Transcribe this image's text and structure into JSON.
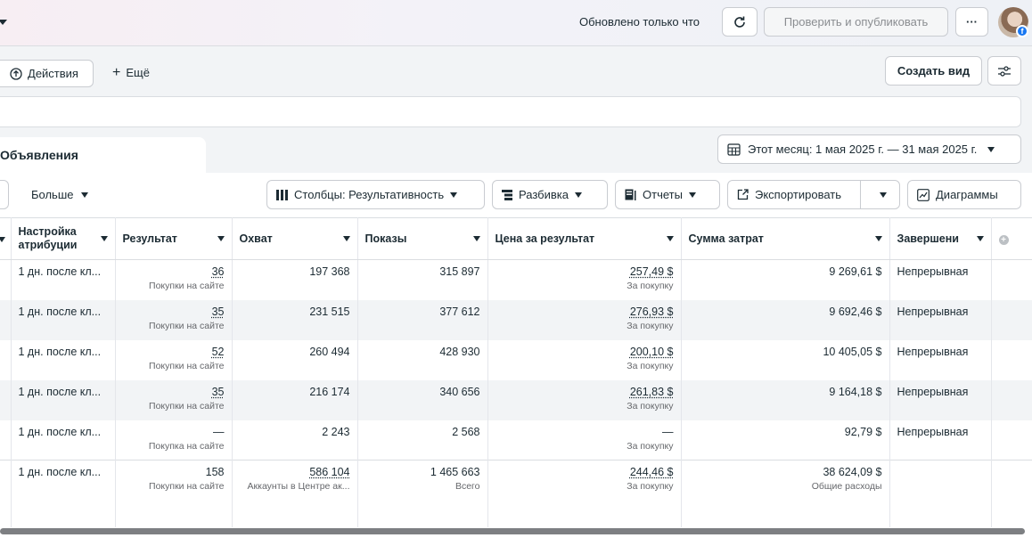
{
  "header": {
    "updated": "Обновлено только что",
    "publish": "Проверить и опубликовать",
    "more": "···"
  },
  "actions": {
    "actions": "Действия",
    "more": "Ещё",
    "create_view": "Создать вид"
  },
  "tab": "Объявления",
  "date_range": "Этот месяц: 1 мая 2025 г. — 31 мая 2025 г.",
  "toolbar": {
    "more": "Больше",
    "columns": "Столбцы: Результативность",
    "breakdown": "Разбивка",
    "reports": "Отчеты",
    "export": "Экспортировать",
    "charts": "Диаграммы"
  },
  "columns": [
    "",
    "Настройка атрибуции",
    "Результат",
    "Охват",
    "Показы",
    "Цена за результат",
    "Сумма затрат",
    "Завершени"
  ],
  "rows": [
    {
      "attr": "1 дн. после кл...",
      "result": "36",
      "result_sub": "Покупки на сайте",
      "reach": "197 368",
      "impr": "315 897",
      "cpr": "257,49 $",
      "cpr_sub": "За покупку",
      "spend": "9 269,61 $",
      "end": "Непрерывная"
    },
    {
      "attr": "1 дн. после кл...",
      "result": "35",
      "result_sub": "Покупки на сайте",
      "reach": "231 515",
      "impr": "377 612",
      "cpr": "276,93 $",
      "cpr_sub": "За покупку",
      "spend": "9 692,46 $",
      "end": "Непрерывная"
    },
    {
      "attr": "1 дн. после кл...",
      "result": "52",
      "result_sub": "Покупки на сайте",
      "reach": "260 494",
      "impr": "428 930",
      "cpr": "200,10 $",
      "cpr_sub": "За покупку",
      "spend": "10 405,05 $",
      "end": "Непрерывная"
    },
    {
      "attr": "1 дн. после кл...",
      "result": "35",
      "result_sub": "Покупки на сайте",
      "reach": "216 174",
      "impr": "340 656",
      "cpr": "261,83 $",
      "cpr_sub": "За покупку",
      "spend": "9 164,18 $",
      "end": "Непрерывная"
    },
    {
      "attr": "1 дн. после кл...",
      "result": "—",
      "result_sub": "Покупка на сайте",
      "reach": "2 243",
      "impr": "2 568",
      "cpr": "—",
      "cpr_sub": "За покупку",
      "spend": "92,79 $",
      "end": "Непрерывная"
    }
  ],
  "total": {
    "attr": "1 дн. после кл...",
    "result": "158",
    "result_sub": "Покупки на сайте",
    "reach": "586 104",
    "reach_sub": "Аккаунты в Центре ак...",
    "impr": "1 465 663",
    "impr_sub": "Всего",
    "cpr": "244,46 $",
    "cpr_sub": "За покупку",
    "spend": "38 624,09 $",
    "spend_sub": "Общие расходы"
  }
}
